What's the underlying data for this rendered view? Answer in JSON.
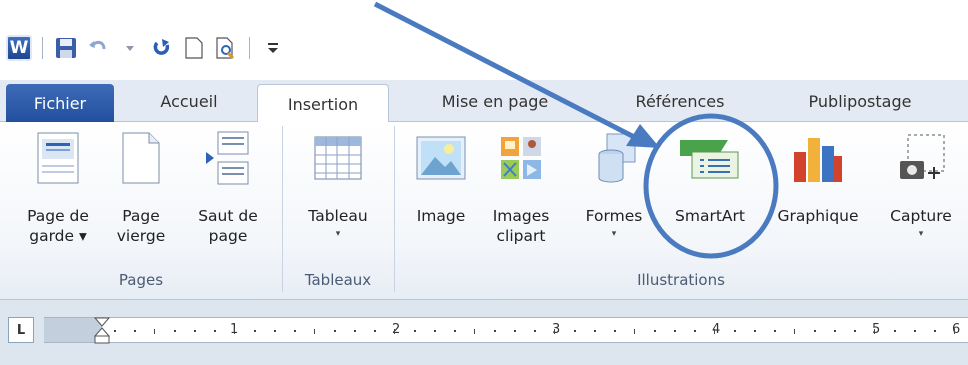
{
  "quick_access": {
    "app_icon": "W",
    "items": [
      "word-app-icon",
      "save-icon",
      "undo-icon",
      "redo-icon",
      "new-document-icon",
      "print-preview-icon",
      "customize-qat-icon"
    ]
  },
  "tabs": {
    "file": "Fichier",
    "home": "Accueil",
    "insert": "Insertion",
    "layout": "Mise en page",
    "references": "Références",
    "mailings": "Publipostage"
  },
  "ribbon": {
    "groups": {
      "pages": "Pages",
      "tables": "Tableaux",
      "illustrations": "Illustrations"
    },
    "commands": {
      "cover_page": {
        "line1": "Page de",
        "line2": "garde ▾"
      },
      "blank_page": {
        "line1": "Page",
        "line2": "vierge"
      },
      "page_break": {
        "line1": "Saut de",
        "line2": "page"
      },
      "table": {
        "line1": "Tableau",
        "arrow": "▾"
      },
      "image": {
        "line1": "Image"
      },
      "clipart": {
        "line1": "Images",
        "line2": "clipart"
      },
      "shapes": {
        "line1": "Formes",
        "arrow": "▾"
      },
      "smartart": {
        "line1": "SmartArt"
      },
      "chart": {
        "line1": "Graphique"
      },
      "screenshot": {
        "line1": "Capture",
        "arrow": "▾"
      }
    }
  },
  "ruler": {
    "tab_selector": "L",
    "numbers": [
      "1",
      "2",
      "3",
      "4",
      "5",
      "6"
    ]
  },
  "colors": {
    "accent": "#2f68b3",
    "file_tab": "#2a57a3",
    "annotation": "#4a7bc0"
  }
}
